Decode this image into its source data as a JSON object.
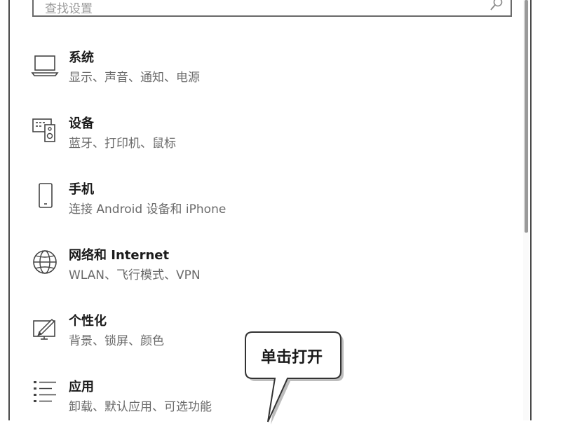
{
  "search": {
    "placeholder": "查找设置"
  },
  "items": [
    {
      "title": "系统",
      "subtitle": "显示、声音、通知、电源",
      "icon": "laptop-icon"
    },
    {
      "title": "设备",
      "subtitle": "蓝牙、打印机、鼠标",
      "icon": "devices-icon"
    },
    {
      "title": "手机",
      "subtitle": "连接 Android 设备和 iPhone",
      "icon": "phone-icon"
    },
    {
      "title": "网络和 Internet",
      "subtitle": "WLAN、飞行模式、VPN",
      "icon": "globe-icon"
    },
    {
      "title": "个性化",
      "subtitle": "背景、锁屏、颜色",
      "icon": "personalization-icon"
    },
    {
      "title": "应用",
      "subtitle": "卸载、默认应用、可选功能",
      "icon": "apps-list-icon"
    }
  ],
  "callout": {
    "text": "单击打开"
  }
}
